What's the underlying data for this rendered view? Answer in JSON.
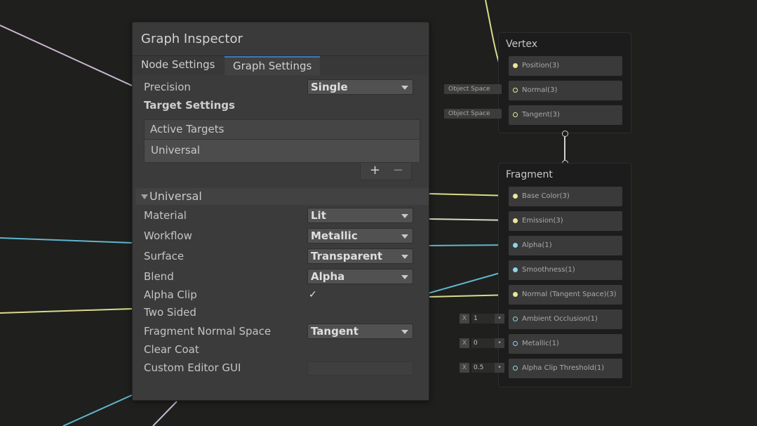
{
  "inspector": {
    "title": "Graph Inspector",
    "tabs": [
      {
        "label": "Node Settings",
        "active": false
      },
      {
        "label": "Graph Settings",
        "active": true
      }
    ],
    "precision": {
      "label": "Precision",
      "value": "Single"
    },
    "target_settings": {
      "heading": "Target Settings",
      "list_header": "Active Targets",
      "items": [
        "Universal"
      ],
      "add_label": "+",
      "remove_label": "−"
    },
    "section": {
      "title": "Universal",
      "expanded": true
    },
    "fields": {
      "material": {
        "label": "Material",
        "value": "Lit"
      },
      "workflow": {
        "label": "Workflow",
        "value": "Metallic"
      },
      "surface": {
        "label": "Surface",
        "value": "Transparent"
      },
      "blend": {
        "label": "Blend",
        "value": "Alpha"
      },
      "alpha_clip": {
        "label": "Alpha Clip",
        "checked": true,
        "mark": "✓"
      },
      "two_sided": {
        "label": "Two Sided",
        "checked": false
      },
      "fragment_normal_space": {
        "label": "Fragment Normal Space",
        "value": "Tangent"
      },
      "clear_coat": {
        "label": "Clear Coat",
        "checked": false
      },
      "custom_editor_gui": {
        "label": "Custom Editor GUI",
        "value": ""
      }
    }
  },
  "vertex": {
    "title": "Vertex",
    "ports": [
      {
        "label": "Position(3)",
        "space": ""
      },
      {
        "label": "Normal(3)",
        "space": "Object Space"
      },
      {
        "label": "Tangent(3)",
        "space": "Object Space"
      }
    ]
  },
  "fragment": {
    "title": "Fragment",
    "ports": [
      {
        "label": "Base Color(3)",
        "color": "#e8e89a"
      },
      {
        "label": "Emission(3)",
        "color": "#e8e89a"
      },
      {
        "label": "Alpha(1)",
        "color": "#8fd3e8"
      },
      {
        "label": "Smoothness(1)",
        "color": "#8fd3e8"
      },
      {
        "label": "Normal (Tangent Space)(3)",
        "color": "#e8e89a"
      },
      {
        "label": "Ambient Occlusion(1)",
        "color": "#8fd3e8"
      },
      {
        "label": "Metallic(1)",
        "color": "#8fd3e8"
      },
      {
        "label": "Alpha Clip Threshold(1)",
        "color": "#8fd3e8"
      }
    ],
    "inline_values": [
      {
        "axis": "X",
        "value": "1"
      },
      {
        "axis": "X",
        "value": "0"
      },
      {
        "axis": "X",
        "value": "0.5"
      }
    ]
  },
  "colors": {
    "background": "#1f1f1d",
    "panel": "#383838",
    "accent_tab": "#3a79bb",
    "vector3_port": "#e8e89a",
    "vector1_port": "#8fd3e8"
  }
}
